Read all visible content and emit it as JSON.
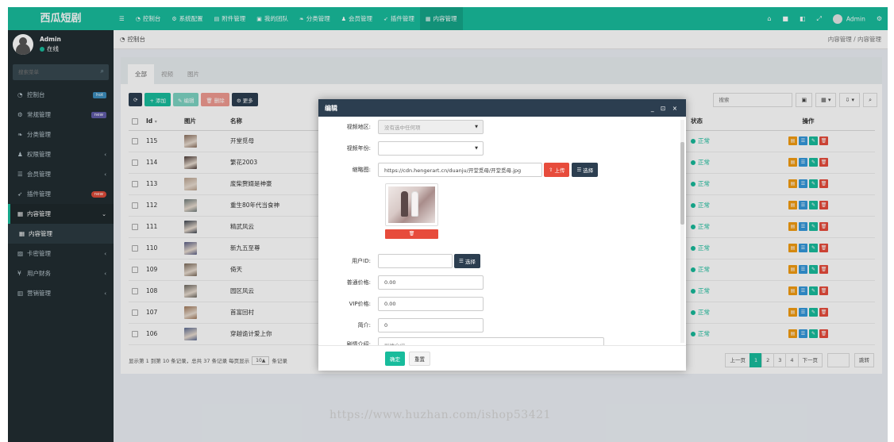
{
  "brand": "西瓜短剧",
  "topnav": {
    "menu_icon": "☰",
    "items": [
      {
        "label": "控制台",
        "icon": "dashboard-icon"
      },
      {
        "label": "系统配置",
        "icon": "cogs-icon"
      },
      {
        "label": "附件管理",
        "icon": "file-icon"
      },
      {
        "label": "我的团队",
        "icon": "team-icon"
      },
      {
        "label": "分类管理",
        "icon": "leaf-icon"
      },
      {
        "label": "会员管理",
        "icon": "user-icon"
      },
      {
        "label": "插件管理",
        "icon": "rocket-icon"
      },
      {
        "label": "内容管理",
        "icon": "file-text-icon"
      }
    ],
    "user": "Admin"
  },
  "sidebar": {
    "user_name": "Admin",
    "status": "在线",
    "search_placeholder": "搜索菜单",
    "items": [
      {
        "label": "控制台",
        "icon": "dashboard-icon",
        "badge": "hot",
        "badge_color": "#3c8dbc"
      },
      {
        "label": "常规管理",
        "icon": "cogs-icon",
        "badge": "new",
        "badge_color": "#605ca8"
      },
      {
        "label": "分类管理",
        "icon": "leaf-icon"
      },
      {
        "label": "权限管理",
        "icon": "group-icon",
        "chevron": "‹"
      },
      {
        "label": "会员管理",
        "icon": "list-icon",
        "chevron": "‹"
      },
      {
        "label": "插件管理",
        "icon": "rocket-icon",
        "badge": "new",
        "badge_color": "#dd4b39"
      },
      {
        "label": "内容管理",
        "icon": "file-icon",
        "chevron": "⌄"
      },
      {
        "label": "内容管理",
        "icon": "file-icon"
      },
      {
        "label": "卡密管理",
        "icon": "image-icon",
        "chevron": "‹"
      },
      {
        "label": "用户财务",
        "icon": "yen-icon",
        "chevron": "‹"
      },
      {
        "label": "营销管理",
        "icon": "chart-icon",
        "chevron": "‹"
      }
    ]
  },
  "breadcrumb": {
    "left": "控制台",
    "right": "内容管理 / 内容管理"
  },
  "tabs": [
    "全部",
    "视频",
    "图片"
  ],
  "toolbar": {
    "refresh": "⟳",
    "add": "+ 添加",
    "edit": "✎ 编辑",
    "delete": "🗑 删除",
    "more": "⚙ 更多"
  },
  "colors": {
    "primary": "#18bc9c",
    "header": "#2c3e50",
    "danger": "#e74c3c",
    "warning": "#f39c12",
    "info": "#3498db"
  },
  "table": {
    "search_placeholder": "搜索",
    "columns": [
      "Id",
      "图片",
      "名称",
      "状态",
      "操作"
    ],
    "rows": [
      {
        "id": "115",
        "name": "开堂觅母",
        "status": "正常"
      },
      {
        "id": "114",
        "name": "繁花2003",
        "status": "正常"
      },
      {
        "id": "113",
        "name": "废柴赘婿是神豪",
        "status": "正常"
      },
      {
        "id": "112",
        "name": "重生80年代当食神",
        "status": "正常"
      },
      {
        "id": "111",
        "name": "精武风云",
        "status": "正常"
      },
      {
        "id": "110",
        "name": "新九五至尊",
        "status": "正常"
      },
      {
        "id": "109",
        "name": "倚天",
        "status": "正常"
      },
      {
        "id": "108",
        "name": "园区风云",
        "status": "正常"
      },
      {
        "id": "107",
        "name": "首富回村",
        "status": "正常"
      },
      {
        "id": "106",
        "name": "穿越诡计爱上你",
        "status": "正常"
      }
    ]
  },
  "footer": {
    "summary": "显示第 1 到第 10 条记录，总共 37 条记录 每页显示",
    "page_size": "10▲",
    "suffix": "条记录"
  },
  "pager": {
    "prev": "上一页",
    "pages": [
      "1",
      "2",
      "3",
      "4"
    ],
    "next": "下一页",
    "jump": "跳转"
  },
  "modal": {
    "title": "编辑",
    "controls": "_ ⊡ ×",
    "fields": {
      "region_label": "视频地区:",
      "region_value": "没有选中任何项",
      "year_label": "视频年份:",
      "cover_label": "缩略图:",
      "cover_value": "https://cdn.hengerart.cn/duanju/开堂觅母/开堂觅母.jpg",
      "upload": "上传",
      "select": "选择",
      "user_label": "用户ID:",
      "price_label": "普通价格:",
      "price_value": "0.00",
      "vip_label": "VIP价格:",
      "vip_value": "0.00",
      "intro_label": "简介:",
      "intro_value": "0",
      "plot_label": "剧情介绍:",
      "plot_placeholder": "剧情介绍"
    },
    "ok": "确定",
    "reset": "重置"
  },
  "watermark": "https://www.huzhan.com/ishop53421"
}
